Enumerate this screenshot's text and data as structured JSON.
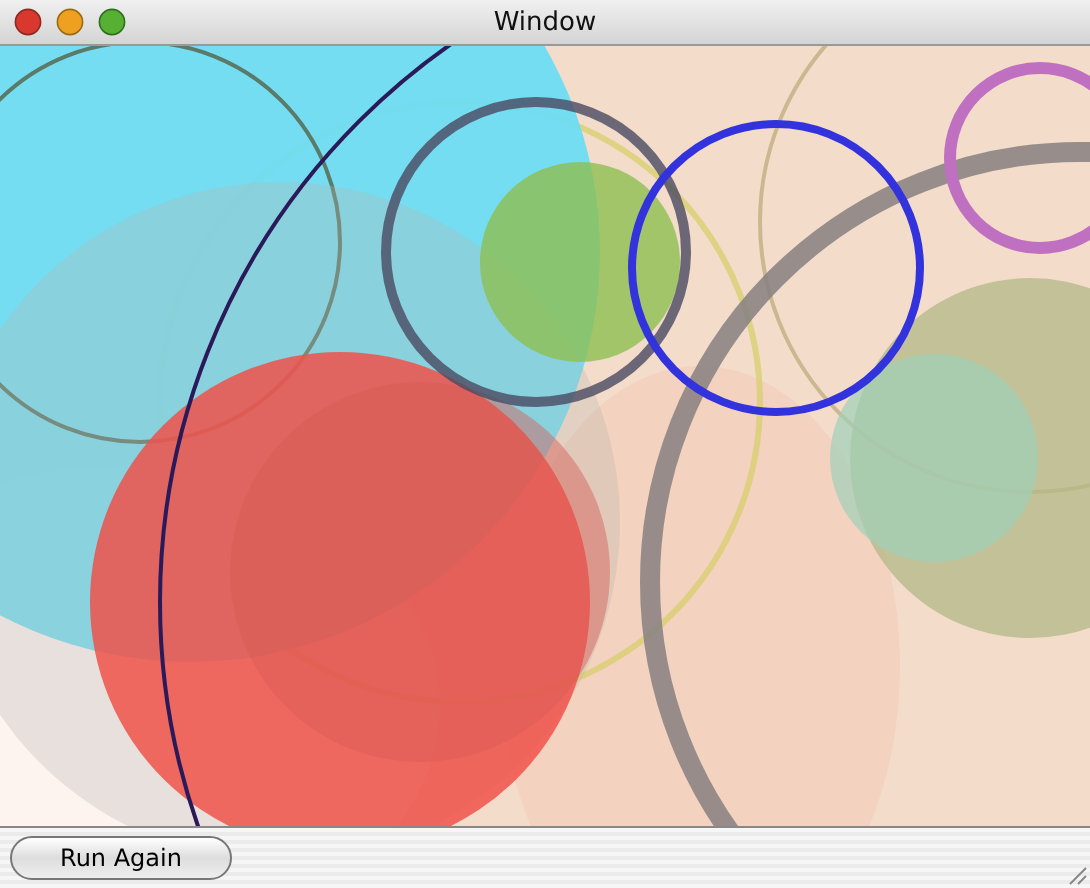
{
  "window": {
    "title": "Window"
  },
  "buttons": [
    {
      "label": "Run Again"
    }
  ]
}
